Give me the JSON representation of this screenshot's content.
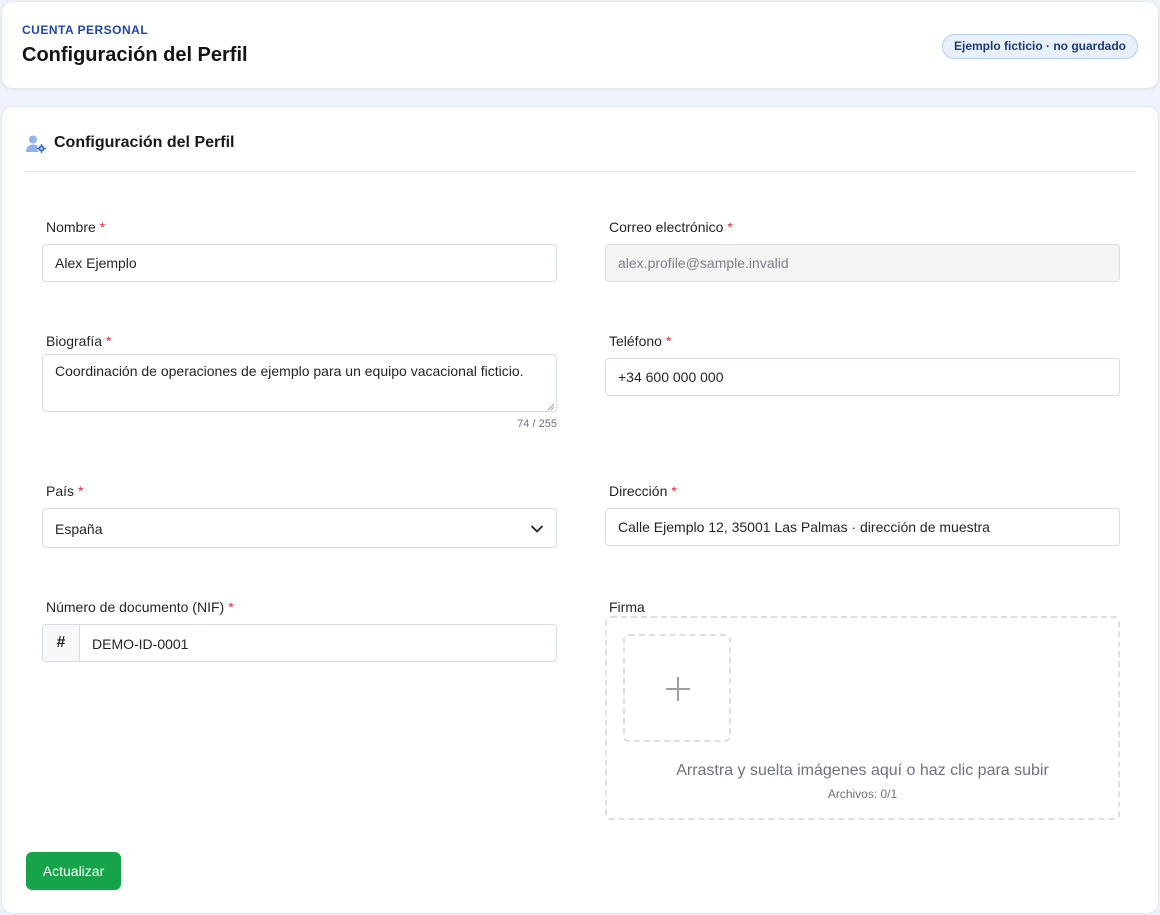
{
  "header": {
    "eyebrow": "CUENTA PERSONAL",
    "title": "Configuración del Perfil",
    "badge": "Ejemplo ficticio · no guardado"
  },
  "section": {
    "title": "Configuración del Perfil",
    "icon": "user-settings-icon"
  },
  "required_marker": "*",
  "fields": {
    "name": {
      "label": "Nombre",
      "value": "Alex Ejemplo"
    },
    "email": {
      "label": "Correo electrónico",
      "value": "alex.profile@sample.invalid",
      "disabled": true
    },
    "bio": {
      "label": "Biografía",
      "value": "Coordinación de operaciones de ejemplo para un equipo vacacional ficticio.",
      "counter": "74 / 255"
    },
    "phone": {
      "label": "Teléfono",
      "value": "+34 600 000 000"
    },
    "country": {
      "label": "País",
      "value": "España"
    },
    "address": {
      "label": "Dirección",
      "value": "Calle Ejemplo 12, 35001 Las Palmas · dirección de muestra"
    },
    "document": {
      "label": "Número de documento (NIF)",
      "prefix": "#",
      "value": "DEMO-ID-0001"
    },
    "signature": {
      "label": "Firma",
      "drop_text": "Arrastra y suelta imágenes aquí o haz clic para subir",
      "count": "Archivos: 0/1"
    }
  },
  "actions": {
    "submit_label": "Actualizar"
  },
  "colors": {
    "accent": "#1f47a6",
    "badge_bg": "#e8f0fc",
    "required": "#d62d3a",
    "submit": "#16a34a"
  }
}
